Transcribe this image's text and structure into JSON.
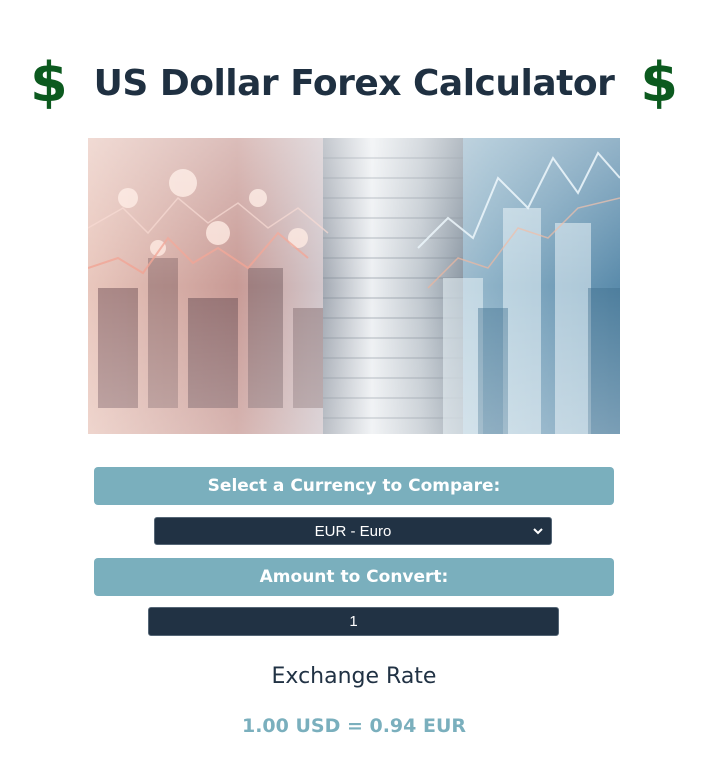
{
  "header": {
    "left_icon": "dollar-sign",
    "right_icon": "dollar-sign",
    "left_glyph": "$",
    "right_glyph": "$",
    "title": "US Dollar Forex Calculator",
    "icon_color": "#0c5a1f",
    "title_color": "#1f3041"
  },
  "hero": {
    "image": "coins-and-finance-charts-city-banner"
  },
  "currency": {
    "label": "Select a Currency to Compare:",
    "selected": "EUR - Euro"
  },
  "amount": {
    "label": "Amount to Convert:",
    "value": "1"
  },
  "result": {
    "heading": "Exchange Rate",
    "text": "1.00 USD = 0.94 EUR"
  },
  "colors": {
    "accent": "#7aafbd",
    "control_bg": "#213244"
  }
}
